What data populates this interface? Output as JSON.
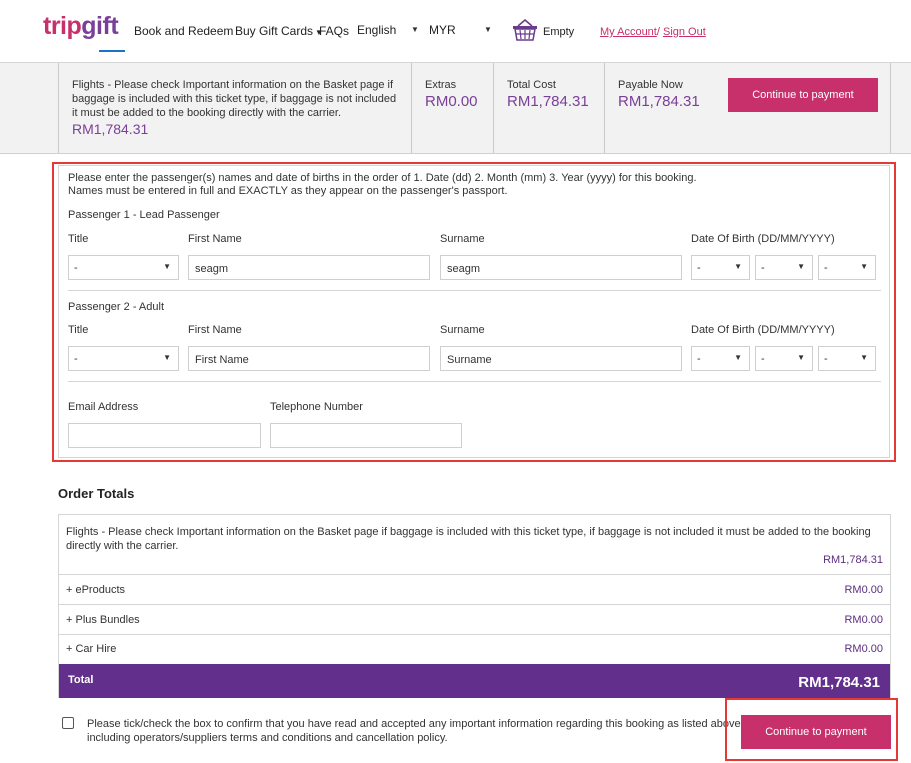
{
  "header": {
    "logo_trip": "trip",
    "logo_gift": "gift",
    "nav": [
      "Book and Redeem",
      "Buy Gift Cards",
      "FAQs",
      "English",
      "MYR"
    ],
    "basket_label": "Empty",
    "my_account": "My Account",
    "separator": "/ ",
    "sign_out": "Sign Out"
  },
  "summary": {
    "flight_desc": "Flights - Please check Important information on the Basket page if baggage is included with this ticket type, if baggage is not included it must be added to the booking directly with the carrier.",
    "flight_price": "RM1,784.31",
    "extras_label": "Extras",
    "extras_value": "RM0.00",
    "total_label": "Total Cost",
    "total_value": "RM1,784.31",
    "payable_label": "Payable Now",
    "payable_value": "RM1,784.31",
    "pay_button": "Continue to payment"
  },
  "form": {
    "intro_line1": "Please enter the passenger(s) names and date of births in the order of 1. Date (dd) 2. Month (mm) 3. Year (yyyy) for this booking.",
    "intro_line2": "Names must be entered in full and EXACTLY as they appear on the passenger's passport.",
    "labels": {
      "title": "Title",
      "first_name": "First Name",
      "surname": "Surname",
      "dob": "Date Of Birth (DD/MM/YYYY)",
      "email": "Email Address",
      "phone": "Telephone Number"
    },
    "passenger1": {
      "heading": "Passenger 1 - Lead Passenger",
      "title": "-",
      "first_name": "seagm",
      "surname": "seagm",
      "dd": "-",
      "mm": "-",
      "yyyy": "-"
    },
    "passenger2": {
      "heading": "Passenger 2 - Adult",
      "title": "-",
      "first_name_placeholder": "First Name",
      "surname_placeholder": "Surname",
      "dd": "-",
      "mm": "-",
      "yyyy": "-"
    },
    "email_value": "",
    "phone_value": ""
  },
  "order_totals": {
    "title": "Order Totals",
    "flight_desc": "Flights - Please check Important information on the Basket page if baggage is included with this ticket type, if baggage is not included it must be added to the booking directly with the carrier.",
    "flight_amount": "RM1,784.31",
    "rows": [
      {
        "label": "+ eProducts",
        "amount": "RM0.00"
      },
      {
        "label": "+ Plus Bundles",
        "amount": "RM0.00"
      },
      {
        "label": "+ Car Hire",
        "amount": "RM0.00"
      }
    ],
    "total_label": "Total",
    "total_amount": "RM1,784.31"
  },
  "confirm_text": "Please tick/check the box to confirm that you have read and accepted any important information regarding this booking as listed above, including operators/suppliers terms and conditions and cancellation policy.",
  "bottom_pay_button": "Continue to payment",
  "colors": {
    "brand_pink": "#c7306b",
    "brand_purple": "#7a3f98",
    "total_bar": "#62308c",
    "highlight_red": "#e53935"
  }
}
